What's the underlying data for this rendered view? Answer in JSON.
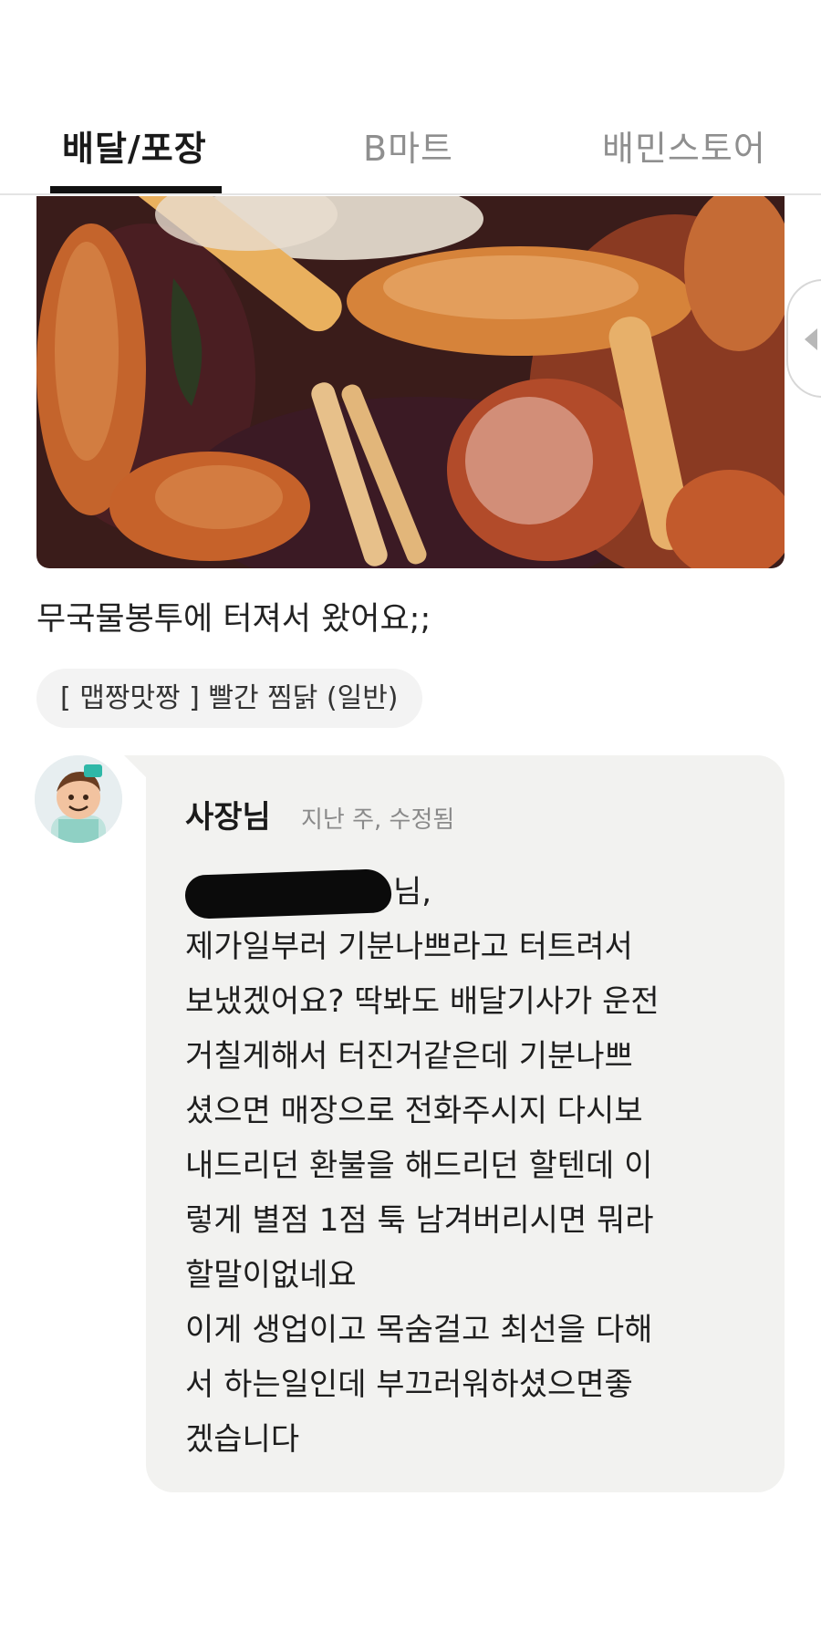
{
  "tabs": [
    {
      "label": "배달/포장",
      "active": true
    },
    {
      "label": "B마트",
      "active": false
    },
    {
      "label": "배민스토어",
      "active": false
    }
  ],
  "review": {
    "text": "무국물봉투에 터져서 왔어요;;",
    "menu_item": "[ 맵짱맛짱 ] 빨간 찜닭 (일반)"
  },
  "owner_reply": {
    "name": "사장님",
    "meta": "지난 주, 수정됨",
    "lines": [
      "님,",
      "제가일부러 기분나쁘라고 터트려서",
      "보냈겠어요? 딱봐도 배달기사가 운전",
      "거칠게해서 터진거같은데 기분나쁘",
      "셨으면 매장으로 전화주시지 다시보",
      "내드리던 환불을 해드리던 할텐데 이",
      "렇게 별점 1점 툭 남겨버리시면 뭐라",
      "할말이없네요",
      "이게 생업이고 목숨걸고 최선을 다해",
      "서 하는일인데 부끄러워하셨으면좋",
      "겠습니다"
    ]
  },
  "colors": {
    "active_tab": "#1a1a1a",
    "inactive_tab": "#8f8f8f",
    "bubble_bg": "#f2f2f0",
    "chip_bg": "#f3f3f3"
  },
  "icons": {
    "carousel": "chevron-left-icon",
    "avatar": "owner-avatar"
  }
}
